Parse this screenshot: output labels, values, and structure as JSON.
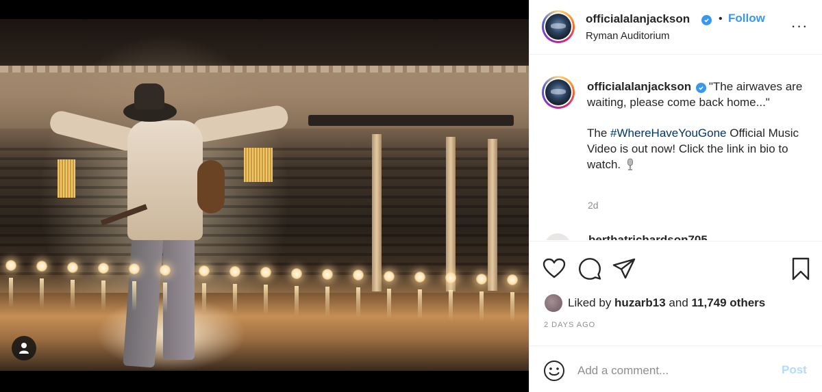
{
  "post": {
    "username": "officialalanjackson",
    "location": "Ryman Auditorium",
    "follow_label": "Follow",
    "separator": "•",
    "more_label": "···"
  },
  "caption": {
    "username": "officialalanjackson",
    "line1": "\"The airwaves are waiting, please come back home...\"",
    "p2_before": "The ",
    "hashtag": "#WhereHaveYouGone",
    "p2_after": " Official Music Video is out now! Click the link in bio to watch.",
    "age": "2d"
  },
  "next_comment": {
    "username": "berthatrichardson705"
  },
  "likes": {
    "prefix": "Liked by ",
    "liker": "huzarb13",
    "middle": " and ",
    "count": "11,749 others"
  },
  "timestamp": "2 DAYS AGO",
  "comment_box": {
    "placeholder": "Add a comment...",
    "post_label": "Post"
  },
  "icons": {
    "like": "heart-icon",
    "comment": "comment-bubble-icon",
    "share": "paper-plane-icon",
    "save": "bookmark-icon",
    "emoji": "smiley-icon",
    "user_tag": "user-tag-icon",
    "verified": "verified-badge-icon"
  },
  "colors": {
    "link_blue": "#3897f0",
    "hashtag_blue": "#00376b",
    "muted": "#8e8e8e",
    "post_disabled": "#b3dbff"
  }
}
